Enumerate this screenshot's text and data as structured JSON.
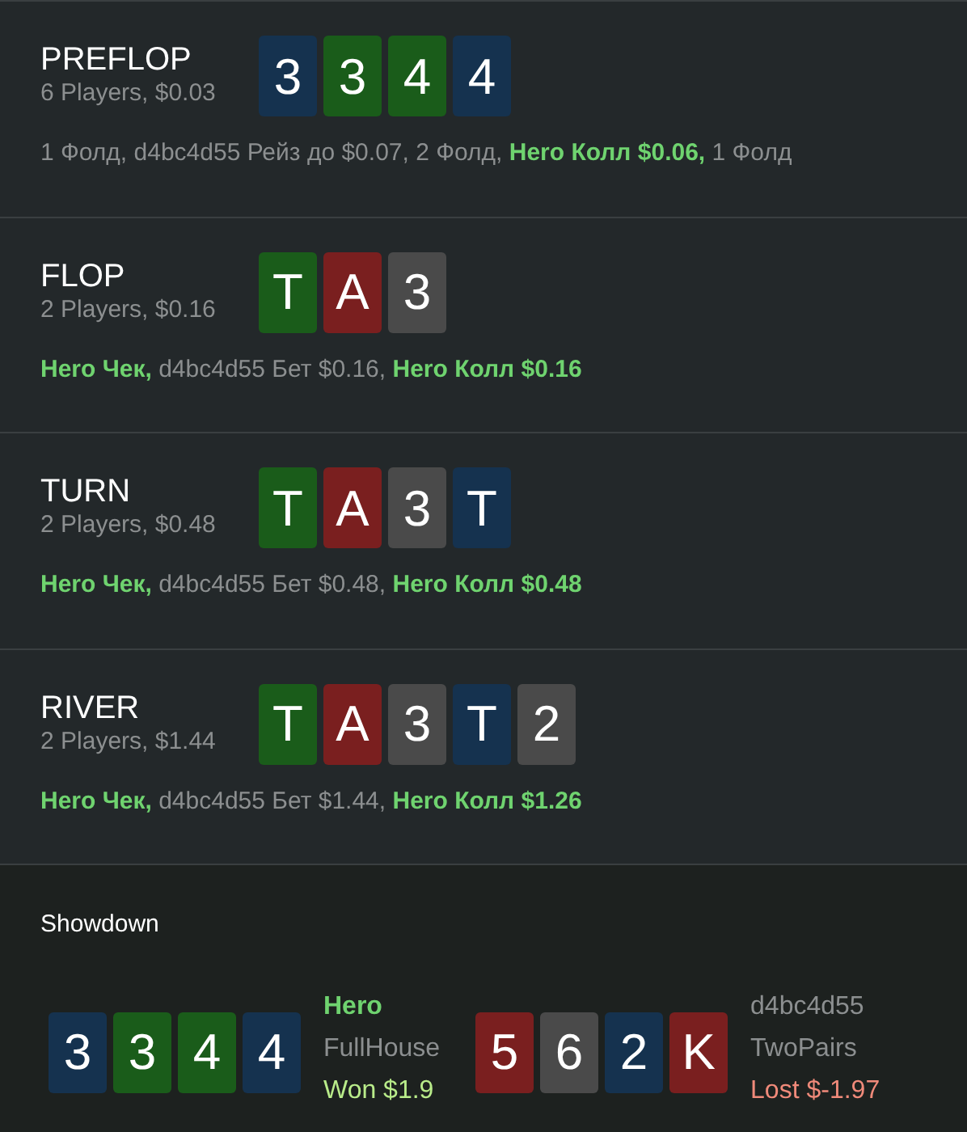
{
  "streets": [
    {
      "name": "PREFLOP",
      "info": "6 Players, $0.03",
      "cards": [
        {
          "rank": "3",
          "color": "#15324f"
        },
        {
          "rank": "3",
          "color": "#1a5c1a"
        },
        {
          "rank": "4",
          "color": "#1a5c1a"
        },
        {
          "rank": "4",
          "color": "#15324f"
        }
      ],
      "actions": [
        {
          "kind": "other",
          "text": "1 Фолд,"
        },
        {
          "kind": "other",
          "text": "d4bc4d55 Рейз до $0.07,"
        },
        {
          "kind": "other",
          "text": "2 Фолд,"
        },
        {
          "kind": "hero",
          "text": "Hero Колл $0.06,"
        },
        {
          "kind": "other",
          "text": "1 Фолд"
        }
      ]
    },
    {
      "name": "FLOP",
      "info": "2 Players, $0.16",
      "cards": [
        {
          "rank": "T",
          "color": "#1a5c1a"
        },
        {
          "rank": "A",
          "color": "#7a1f1f"
        },
        {
          "rank": "3",
          "color": "#4a4a4a"
        }
      ],
      "actions": [
        {
          "kind": "hero",
          "text": "Hero Чек,"
        },
        {
          "kind": "other",
          "text": "d4bc4d55 Бет $0.16,"
        },
        {
          "kind": "hero",
          "text": "Hero Колл $0.16"
        }
      ]
    },
    {
      "name": "TURN",
      "info": "2 Players, $0.48",
      "cards": [
        {
          "rank": "T",
          "color": "#1a5c1a"
        },
        {
          "rank": "A",
          "color": "#7a1f1f"
        },
        {
          "rank": "3",
          "color": "#4a4a4a"
        },
        {
          "rank": "T",
          "color": "#15324f"
        }
      ],
      "actions": [
        {
          "kind": "hero",
          "text": "Hero Чек,"
        },
        {
          "kind": "other",
          "text": "d4bc4d55 Бет $0.48,"
        },
        {
          "kind": "hero",
          "text": "Hero Колл $0.48"
        }
      ]
    },
    {
      "name": "RIVER",
      "info": "2 Players, $1.44",
      "cards": [
        {
          "rank": "T",
          "color": "#1a5c1a"
        },
        {
          "rank": "A",
          "color": "#7a1f1f"
        },
        {
          "rank": "3",
          "color": "#4a4a4a"
        },
        {
          "rank": "T",
          "color": "#15324f"
        },
        {
          "rank": "2",
          "color": "#4a4a4a"
        }
      ],
      "actions": [
        {
          "kind": "hero",
          "text": "Hero Чек,"
        },
        {
          "kind": "other",
          "text": "d4bc4d55 Бет $1.44,"
        },
        {
          "kind": "hero",
          "text": "Hero Колл $1.26"
        }
      ]
    }
  ],
  "showdown": {
    "title": "Showdown",
    "players": [
      {
        "name": "Hero",
        "kind": "hero",
        "hand": "FullHouse",
        "result": "Won $1.9",
        "won": true,
        "cards": [
          {
            "rank": "3",
            "color": "#15324f"
          },
          {
            "rank": "3",
            "color": "#1a5c1a"
          },
          {
            "rank": "4",
            "color": "#1a5c1a"
          },
          {
            "rank": "4",
            "color": "#15324f"
          }
        ]
      },
      {
        "name": "d4bc4d55",
        "kind": "other",
        "hand": "TwoPairs",
        "result": "Lost $-1.97",
        "won": false,
        "cards": [
          {
            "rank": "5",
            "color": "#7a1f1f"
          },
          {
            "rank": "6",
            "color": "#4a4a4a"
          },
          {
            "rank": "2",
            "color": "#15324f"
          },
          {
            "rank": "K",
            "color": "#7a1f1f"
          }
        ]
      }
    ]
  }
}
